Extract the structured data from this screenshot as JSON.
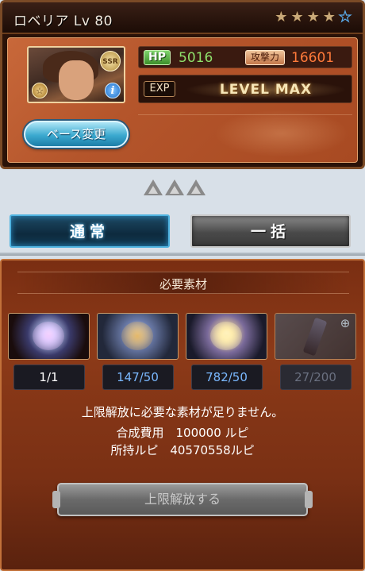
{
  "character": {
    "name": "ロベリア Lv 80",
    "stars": [
      {
        "state": "filled"
      },
      {
        "state": "filled"
      },
      {
        "state": "filled"
      },
      {
        "state": "filled"
      },
      {
        "state": "empty"
      }
    ],
    "rarity_badge": "SSR",
    "hp_label": "HP",
    "hp_value": "5016",
    "atk_label": "攻撃力",
    "atk_value": "16601",
    "exp_label": "EXP",
    "exp_status": "LEVEL MAX",
    "base_change_label": "ベース変更"
  },
  "limit_break_markers": [
    "limit-triangle",
    "limit-triangle",
    "limit-triangle"
  ],
  "modes": {
    "normal_label": "通常",
    "bulk_label": "一括",
    "active": "normal"
  },
  "materials": {
    "title": "必要素材",
    "items": [
      {
        "count": "1/1",
        "count_color": "#ffffff",
        "enabled": true
      },
      {
        "count": "147/50",
        "count_color": "#7ab8ff",
        "enabled": true
      },
      {
        "count": "782/50",
        "count_color": "#7ab8ff",
        "enabled": true
      },
      {
        "count": "27/200",
        "count_color": "#6a7080",
        "enabled": false
      }
    ],
    "message": "上限解放に必要な素材が足りません。",
    "cost_line": "合成費用　100000 ルピ",
    "owned_line": "所持ルピ　40570558ルピ",
    "limit_break_button": "上限解放する"
  },
  "colors": {
    "accent_blue": "#4fb3e0",
    "hp_green": "#8fe06a",
    "atk_orange": "#ff7a3a",
    "panel_brown": "#8c3a18"
  }
}
